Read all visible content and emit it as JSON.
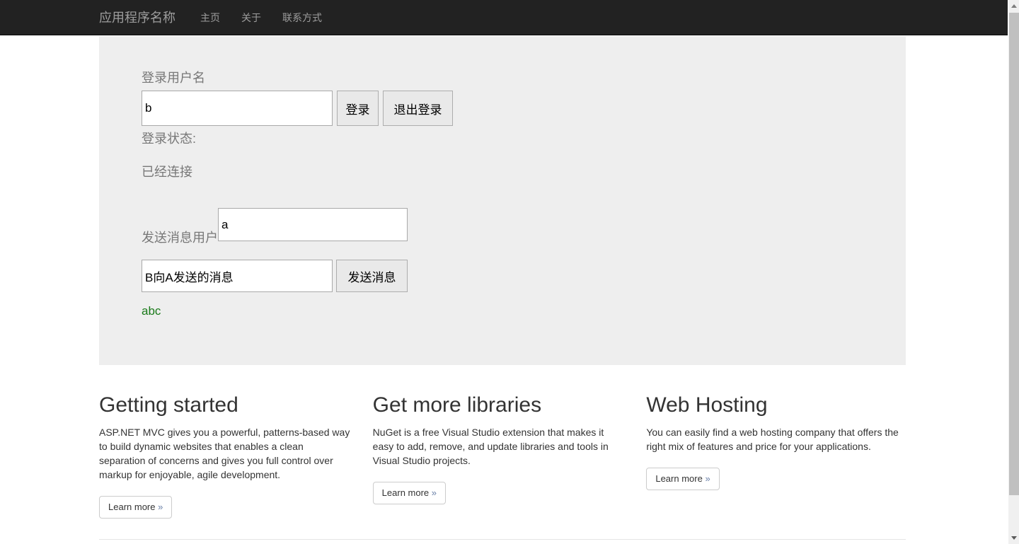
{
  "navbar": {
    "brand": "应用程序名称",
    "links": [
      {
        "label": "主页"
      },
      {
        "label": "关于"
      },
      {
        "label": "联系方式"
      }
    ]
  },
  "jumbotron": {
    "login_label": "登录用户名",
    "login_input_value": "b",
    "login_button": "登录",
    "logout_button": "退出登录",
    "status_label": "登录状态:",
    "status_value": "已经连接",
    "to_user_label": "发送消息用户",
    "to_user_value": "a",
    "message_value": "B向A发送的消息",
    "send_button": "发送消息",
    "log_line": "abc"
  },
  "features": [
    {
      "title": "Getting started",
      "text": "ASP.NET MVC gives you a powerful, patterns-based way to build dynamic websites that enables a clean separation of concerns and gives you full control over markup for enjoyable, agile development.",
      "link_label": "Learn more",
      "link_raquo": "»"
    },
    {
      "title": "Get more libraries",
      "text": "NuGet is a free Visual Studio extension that makes it easy to add, remove, and update libraries and tools in Visual Studio projects.",
      "link_label": "Learn more",
      "link_raquo": "»"
    },
    {
      "title": "Web Hosting",
      "text": "You can easily find a web hosting company that offers the right mix of features and price for your applications.",
      "link_label": "Learn more",
      "link_raquo": "»"
    }
  ],
  "colors": {
    "navbar_bg": "#222222",
    "navbar_text": "#9d9d9d",
    "jumbotron_bg": "#eeeeee",
    "muted_text": "#777777",
    "log_green": "#1a7a1a",
    "body_text": "#333333",
    "scrollbar_thumb": "#c0c0c0"
  }
}
